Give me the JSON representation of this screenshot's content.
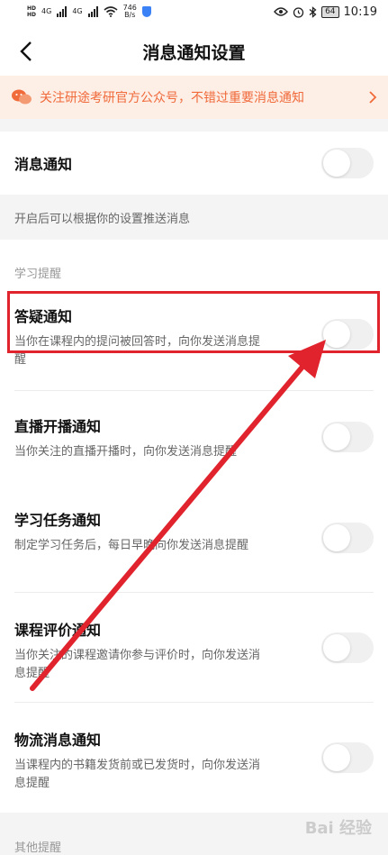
{
  "status_bar": {
    "hd1": "HD",
    "hd2": "HD",
    "net1": "4G",
    "net2": "4G",
    "speed_value": "746",
    "speed_unit": "B/s",
    "battery": "64",
    "time": "10:19"
  },
  "nav": {
    "title": "消息通知设置"
  },
  "banner": {
    "text": "关注研途考研官方公众号，不错过重要消息通知",
    "accent": "#f06a3a"
  },
  "main_toggle": {
    "title": "消息通知",
    "hint": "开启后可以根据你的设置推送消息"
  },
  "sections": {
    "study": "学习提醒",
    "other": "其他提醒"
  },
  "items": [
    {
      "title": "答疑通知",
      "desc": "当你在课程内的提问被回答时，向你发送消息提醒"
    },
    {
      "title": "直播开播通知",
      "desc": "当你关注的直播开播时，向你发送消息提醒"
    },
    {
      "title": "学习任务通知",
      "desc": "制定学习任务后，每日早晚向你发送消息提醒"
    },
    {
      "title": "课程评价通知",
      "desc": "当你关注的课程邀请你参与评价时，向你发送消息提醒"
    },
    {
      "title": "物流消息通知",
      "desc": "当课程内的书籍发货前或已发货时，向你发送消息提醒"
    }
  ],
  "annotation_color": "#e0232d",
  "watermark": "Bai 经验"
}
